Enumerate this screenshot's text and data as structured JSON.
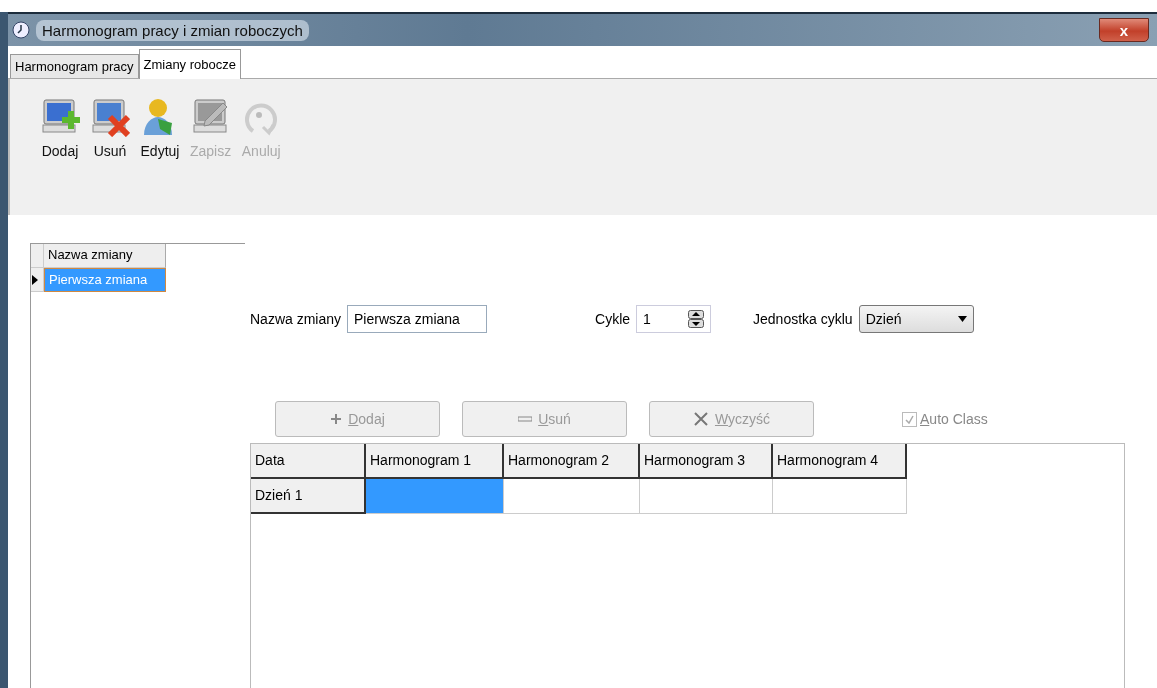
{
  "window": {
    "title": "Harmonogram pracy i zmian roboczych",
    "close": "x"
  },
  "tabs": [
    {
      "label": "Harmonogram pracy",
      "selected": false
    },
    {
      "label": "Zmiany robocze",
      "selected": true
    }
  ],
  "toolbar": [
    {
      "label": "Dodaj",
      "kind": "add",
      "disabled": false
    },
    {
      "label": "Usuń",
      "kind": "remove",
      "disabled": false
    },
    {
      "label": "Edytuj",
      "kind": "edit",
      "disabled": false
    },
    {
      "label": "Zapisz",
      "kind": "save",
      "disabled": true
    },
    {
      "label": "Anuluj",
      "kind": "cancel",
      "disabled": true
    }
  ],
  "shift_list": {
    "column": "Nazwa zmiany",
    "rows": [
      {
        "name": "Pierwsza zmiana",
        "selected": true
      }
    ]
  },
  "form": {
    "name_label": "Nazwa zmiany",
    "name_value": "Pierwsza zmiana",
    "cycles_label": "Cykle",
    "cycles_value": "1",
    "unit_label": "Jednostka cyklu",
    "unit_value": "Dzień"
  },
  "actions": [
    {
      "label": "Dodaj",
      "kind": "plus",
      "disabled": true
    },
    {
      "label": "Usuń",
      "kind": "minus",
      "disabled": true
    },
    {
      "label": "Wyczyść",
      "kind": "clear",
      "disabled": true
    }
  ],
  "auto_class": {
    "label": "Auto Class",
    "checked": true,
    "disabled": true
  },
  "schedule": {
    "columns": [
      "Data",
      "Harmonogram 1",
      "Harmonogram 2",
      "Harmonogram 3",
      "Harmonogram 4"
    ],
    "rows": [
      {
        "label": "Dzień 1",
        "cells": [
          {
            "selected": true
          },
          {
            "selected": false
          },
          {
            "selected": false
          },
          {
            "selected": false
          }
        ]
      }
    ]
  }
}
